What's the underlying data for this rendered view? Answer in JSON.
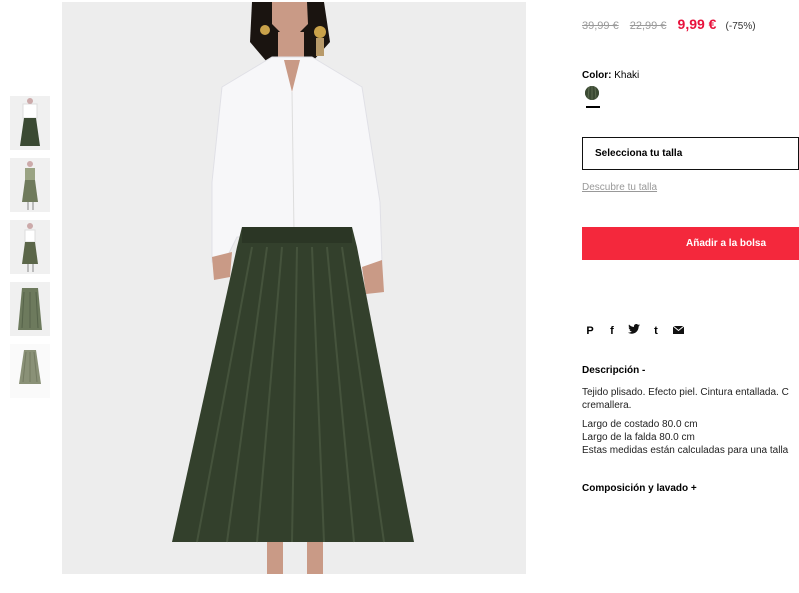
{
  "product": {
    "prices": {
      "original": "39,99 €",
      "previous": "22,99 €",
      "current": "9,99 €",
      "discount": "(-75%)"
    },
    "color": {
      "label": "Color:",
      "value": "Khaki",
      "swatch_color": "#3b4a33"
    },
    "size_select": {
      "placeholder": "Selecciona tu talla"
    },
    "size_guide": "Descubre tu talla",
    "add_to_bag": "Añadir a la bolsa",
    "share_icons": [
      "pinterest-icon",
      "facebook-icon",
      "twitter-icon",
      "tumblr-icon",
      "email-icon"
    ],
    "description": {
      "title": "Descripción -",
      "paragraph1": "Tejido plisado. Efecto piel. Cintura entallada. C\ncremallera.",
      "paragraph2": "Largo de costado 80.0 cm\nLargo de la falda 80.0 cm\nEstas medidas están calculadas para una talla"
    },
    "composition": {
      "title": "Composición y lavado +"
    }
  },
  "colors": {
    "accent": "#f4283c",
    "sale_price": "#e8123c",
    "skirt": "#3b4a33"
  }
}
